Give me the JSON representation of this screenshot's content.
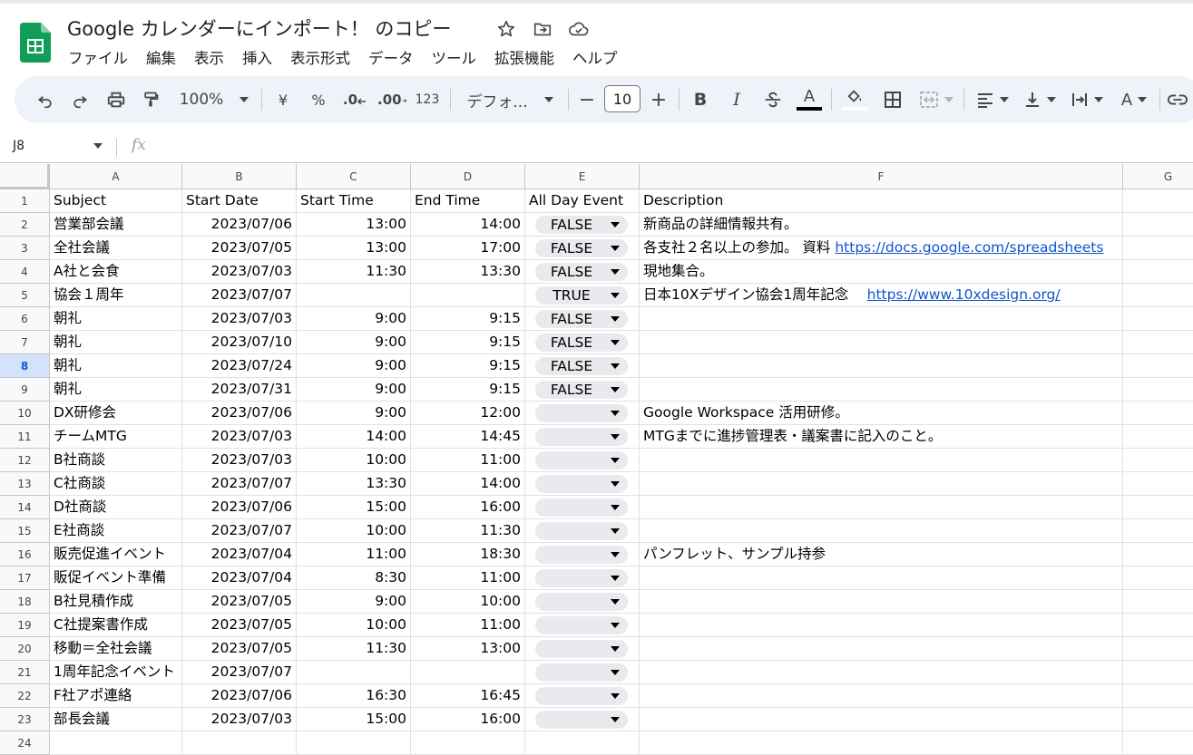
{
  "header": {
    "title": "Google カレンダーにインポート！ のコピー",
    "menu": [
      "ファイル",
      "編集",
      "表示",
      "挿入",
      "表示形式",
      "データ",
      "ツール",
      "拡張機能",
      "ヘルプ"
    ]
  },
  "toolbar": {
    "zoom": "100%",
    "currency": "¥",
    "percent": "%",
    "dec_minus": ".0",
    "dec_plus": ".00",
    "number_format": "123",
    "font": "デフォ...",
    "font_size": "10",
    "minus": "−",
    "plus": "+",
    "bold": "B",
    "italic": "I",
    "text_color": "A",
    "text_rotate": "A"
  },
  "formula_bar": {
    "name_box": "J8",
    "fx": "fx"
  },
  "grid": {
    "columns": [
      "A",
      "B",
      "C",
      "D",
      "E",
      "F",
      "G"
    ],
    "selected_row": 8,
    "header_row": {
      "a": "Subject",
      "b": "Start Date",
      "c": "Start Time",
      "d": "End Time",
      "e": "All Day Event",
      "f": "Description"
    },
    "rows": [
      {
        "n": "2",
        "a": "営業部会議",
        "b": "2023/07/06",
        "c": "13:00",
        "d": "14:00",
        "e": "FALSE",
        "f": "新商品の詳細情報共有。",
        "link": ""
      },
      {
        "n": "3",
        "a": "全社会議",
        "b": "2023/07/05",
        "c": "13:00",
        "d": "17:00",
        "e": "FALSE",
        "f": "各支社２名以上の参加。 資料 ",
        "link": "https://docs.google.com/spreadsheets"
      },
      {
        "n": "4",
        "a": "A社と会食",
        "b": "2023/07/03",
        "c": "11:30",
        "d": "13:30",
        "e": "FALSE",
        "f": "現地集合。",
        "link": ""
      },
      {
        "n": "5",
        "a": "協会１周年",
        "b": "2023/07/07",
        "c": "",
        "d": "",
        "e": "TRUE",
        "f": "日本10Xデザイン協会1周年記念　 ",
        "link": "https://www.10xdesign.org/"
      },
      {
        "n": "6",
        "a": "朝礼",
        "b": "2023/07/03",
        "c": "9:00",
        "d": "9:15",
        "e": "FALSE",
        "f": "",
        "link": ""
      },
      {
        "n": "7",
        "a": "朝礼",
        "b": "2023/07/10",
        "c": "9:00",
        "d": "9:15",
        "e": "FALSE",
        "f": "",
        "link": ""
      },
      {
        "n": "8",
        "a": "朝礼",
        "b": "2023/07/24",
        "c": "9:00",
        "d": "9:15",
        "e": "FALSE",
        "f": "",
        "link": ""
      },
      {
        "n": "9",
        "a": "朝礼",
        "b": "2023/07/31",
        "c": "9:00",
        "d": "9:15",
        "e": "FALSE",
        "f": "",
        "link": ""
      },
      {
        "n": "10",
        "a": "DX研修会",
        "b": "2023/07/06",
        "c": "9:00",
        "d": "12:00",
        "e": "",
        "f": " Google Workspace 活用研修。",
        "link": ""
      },
      {
        "n": "11",
        "a": "チームMTG",
        "b": "2023/07/03",
        "c": "14:00",
        "d": "14:45",
        "e": "",
        "f": "MTGまでに進捗管理表・議案書に記入のこと。",
        "link": ""
      },
      {
        "n": "12",
        "a": "B社商談",
        "b": "2023/07/03",
        "c": "10:00",
        "d": "11:00",
        "e": "",
        "f": "",
        "link": ""
      },
      {
        "n": "13",
        "a": "C社商談",
        "b": "2023/07/07",
        "c": "13:30",
        "d": "14:00",
        "e": "",
        "f": "",
        "link": ""
      },
      {
        "n": "14",
        "a": "D社商談",
        "b": "2023/07/06",
        "c": "15:00",
        "d": "16:00",
        "e": "",
        "f": "",
        "link": ""
      },
      {
        "n": "15",
        "a": "E社商談",
        "b": "2023/07/07",
        "c": "10:00",
        "d": "11:30",
        "e": "",
        "f": "",
        "link": ""
      },
      {
        "n": "16",
        "a": "販売促進イベント",
        "b": "2023/07/04",
        "c": "11:00",
        "d": "18:30",
        "e": "",
        "f": "パンフレット、サンプル持参",
        "link": ""
      },
      {
        "n": "17",
        "a": "販促イベント準備",
        "b": "2023/07/04",
        "c": "8:30",
        "d": "11:00",
        "e": "",
        "f": "",
        "link": ""
      },
      {
        "n": "18",
        "a": "B社見積作成",
        "b": "2023/07/05",
        "c": "9:00",
        "d": "10:00",
        "e": "",
        "f": "",
        "link": ""
      },
      {
        "n": "19",
        "a": "C社提案書作成",
        "b": "2023/07/05",
        "c": "10:00",
        "d": "11:00",
        "e": "",
        "f": "",
        "link": ""
      },
      {
        "n": "20",
        "a": "移動＝全社会議",
        "b": "2023/07/05",
        "c": "11:30",
        "d": "13:00",
        "e": "",
        "f": "",
        "link": ""
      },
      {
        "n": "21",
        "a": "1周年記念イベント",
        "b": "2023/07/07",
        "c": "",
        "d": "",
        "e": "",
        "f": "",
        "link": ""
      },
      {
        "n": "22",
        "a": "F社アポ連絡",
        "b": "2023/07/06",
        "c": "16:30",
        "d": "16:45",
        "e": "",
        "f": "",
        "link": ""
      },
      {
        "n": "23",
        "a": "部長会議",
        "b": "2023/07/03",
        "c": "15:00",
        "d": "16:00",
        "e": "",
        "f": "",
        "link": ""
      }
    ],
    "extra_row": "24"
  }
}
